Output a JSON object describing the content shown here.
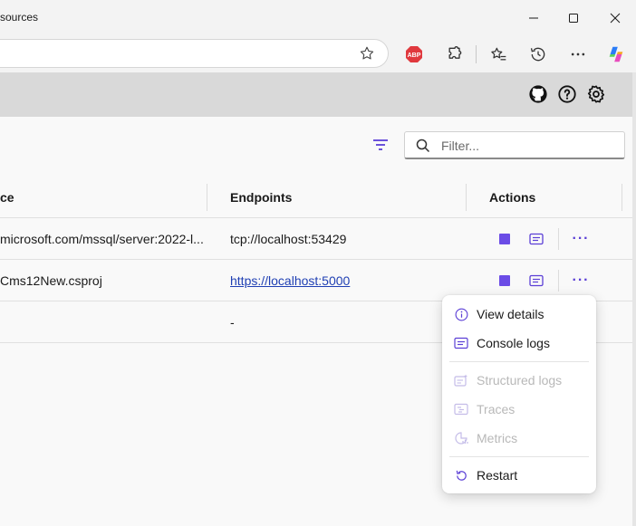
{
  "window": {
    "title": "sources"
  },
  "browser": {
    "icons": [
      "star-icon",
      "adblock-icon",
      "extensions-icon",
      "favorites-icon",
      "history-icon",
      "more-icon",
      "copilot-icon"
    ],
    "adblock_text": "ABP"
  },
  "app_header": {
    "icons": [
      "github-icon",
      "help-icon",
      "settings-icon"
    ]
  },
  "filter": {
    "placeholder": "Filter..."
  },
  "table": {
    "headers": {
      "source": "ce",
      "endpoints": "Endpoints",
      "actions": "Actions"
    },
    "rows": [
      {
        "source": "microsoft.com/mssql/server:2022-l...",
        "endpoint": "tcp://localhost:53429",
        "endpoint_is_link": false
      },
      {
        "source": "Cms12New.csproj",
        "endpoint": "https://localhost:5000",
        "endpoint_is_link": true
      },
      {
        "source": "",
        "endpoint": "-",
        "endpoint_is_link": false
      }
    ],
    "more_label": "···"
  },
  "context_menu": {
    "items": [
      {
        "label": "View details",
        "icon": "info-icon",
        "enabled": true
      },
      {
        "label": "Console logs",
        "icon": "console-logs-icon",
        "enabled": true
      },
      {
        "label": "Structured logs",
        "icon": "structured-logs-icon",
        "enabled": false
      },
      {
        "label": "Traces",
        "icon": "traces-icon",
        "enabled": false
      },
      {
        "label": "Metrics",
        "icon": "metrics-icon",
        "enabled": false
      },
      {
        "label": "Restart",
        "icon": "restart-icon",
        "enabled": true
      }
    ]
  },
  "colors": {
    "accent": "#6b4ce6",
    "link": "#1f3fb3",
    "header_bg": "#d9d9d9"
  }
}
